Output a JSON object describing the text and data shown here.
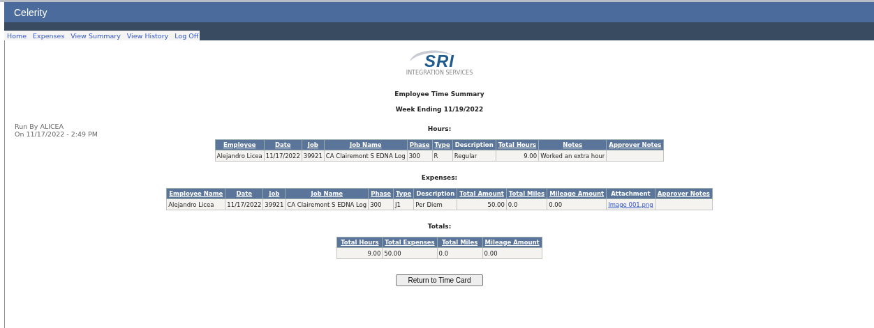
{
  "app": {
    "title": "Celerity"
  },
  "nav": [
    {
      "label": "Home"
    },
    {
      "label": "Expenses"
    },
    {
      "label": "View Summary"
    },
    {
      "label": "View History"
    },
    {
      "label": "Log Off"
    }
  ],
  "run_info": [
    "Run By ALICEA",
    "On 11/17/2022 - 2:49 PM"
  ],
  "logo": {
    "name": "SRI",
    "tagline": "INTEGRATION SERVICES"
  },
  "title": "Employee Time Summary",
  "subtitle": "Week Ending 11/19/2022",
  "sections": [
    {
      "heading": "Hours:",
      "columns": [
        {
          "label": "Employee",
          "link": true
        },
        {
          "label": "Date",
          "link": true
        },
        {
          "label": "Job",
          "link": true
        },
        {
          "label": "Job Name",
          "link": true
        },
        {
          "label": "Phase",
          "link": true
        },
        {
          "label": "Type",
          "link": true
        },
        {
          "label": "Description",
          "link": false
        },
        {
          "label": "Total Hours",
          "link": true
        },
        {
          "label": "Notes",
          "link": true
        },
        {
          "label": "Approver Notes",
          "link": true
        }
      ],
      "rows": [
        [
          {
            "text": "Alejandro Licea"
          },
          {
            "text": "11/17/2022"
          },
          {
            "text": "39921"
          },
          {
            "text": "CA Clairemont S EDNA Log"
          },
          {
            "text": "300"
          },
          {
            "text": "R"
          },
          {
            "text": "Regular"
          },
          {
            "text": "9.00",
            "numeric": true
          },
          {
            "text": "Worked an extra hour"
          },
          {
            "text": ""
          }
        ]
      ]
    },
    {
      "heading": "Expenses:",
      "columns": [
        {
          "label": "Employee Name",
          "link": true
        },
        {
          "label": "Date",
          "link": true
        },
        {
          "label": "Job",
          "link": true
        },
        {
          "label": "Job Name",
          "link": true
        },
        {
          "label": "Phase",
          "link": true
        },
        {
          "label": "Type",
          "link": true
        },
        {
          "label": "Description",
          "link": false
        },
        {
          "label": "Total Amount",
          "link": true
        },
        {
          "label": "Total Miles",
          "link": true
        },
        {
          "label": "Mileage Amount",
          "link": true
        },
        {
          "label": "Attachment",
          "link": false
        },
        {
          "label": "Approver Notes",
          "link": true
        }
      ],
      "rows": [
        [
          {
            "text": "Alejandro Licea"
          },
          {
            "text": "11/17/2022"
          },
          {
            "text": "39921"
          },
          {
            "text": "CA Clairemont S EDNA Log"
          },
          {
            "text": "300"
          },
          {
            "text": "J1"
          },
          {
            "text": "Per Diem"
          },
          {
            "text": "50.00",
            "numeric": true
          },
          {
            "text": "0.0"
          },
          {
            "text": "0.00"
          },
          {
            "text": "Image 001.png",
            "link": true
          },
          {
            "text": ""
          }
        ]
      ]
    },
    {
      "heading": "Totals:",
      "columns": [
        {
          "label": "Total Hours",
          "link": true
        },
        {
          "label": "Total Expenses",
          "link": true
        },
        {
          "label": "Total Miles",
          "link": true
        },
        {
          "label": "Mileage Amount",
          "link": true
        }
      ],
      "rows": [
        [
          {
            "text": "9.00",
            "numeric": true
          },
          {
            "text": "50.00"
          },
          {
            "text": "0.0"
          },
          {
            "text": "0.00"
          }
        ]
      ]
    }
  ],
  "button": "Return to Time Card"
}
